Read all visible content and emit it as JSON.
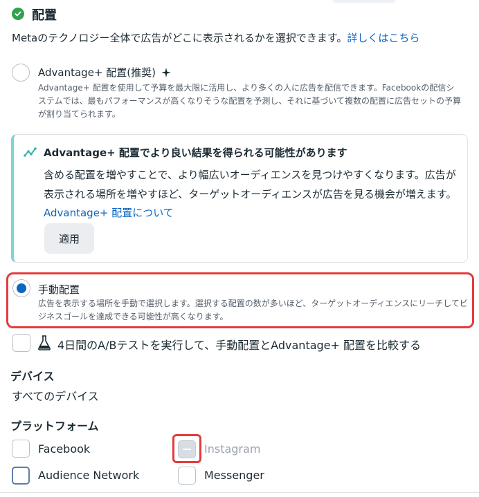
{
  "header": {
    "title": "配置",
    "description": "Metaのテクノロジー全体で広告がどこに表示されるかを選択できます。",
    "learn_more": "詳しくはこちら"
  },
  "advantage_option": {
    "title": "Advantage+ 配置(推奨)",
    "description": "Advantage+ 配置を使用して予算を最大限に活用し、より多くの人に広告を配信できます。Facebookの配信システムでは、最もパフォーマンスが高くなりそうな配置を予測し、それに基づいて複数の配置に広告セットの予算が割り当てられます。",
    "selected": false
  },
  "tip": {
    "title": "Advantage+ 配置でより良い結果を得られる可能性があります",
    "body": "含める配置を増やすことで、より幅広いオーディエンスを見つけやすくなります。広告が表示される場所を増やすほど、ターゲットオーディエンスが広告を見る機会が増えます。",
    "link": "Advantage+ 配置について",
    "apply_label": "適用"
  },
  "manual_option": {
    "title": "手動配置",
    "description": "広告を表示する場所を手動で選択します。選択する配置の数が多いほど、ターゲットオーディエンスにリーチしてビジネスゴールを達成できる可能性が高くなります。",
    "selected": true
  },
  "ab_test": {
    "label": "4日間のA/Bテストを実行して、手動配置とAdvantage+ 配置を比較する",
    "checked": false
  },
  "devices": {
    "title": "デバイス",
    "value": "すべてのデバイス"
  },
  "platforms": {
    "title": "プラットフォーム",
    "items": [
      {
        "label": "Facebook",
        "state": "unchecked"
      },
      {
        "label": "Instagram",
        "state": "indeterminate-disabled"
      },
      {
        "label": "Audience Network",
        "state": "unchecked-focused"
      },
      {
        "label": "Messenger",
        "state": "unchecked"
      }
    ]
  },
  "colors": {
    "accent": "#0a66c2",
    "success": "#31a24c",
    "highlight": "#e43b3b",
    "tip_border": "#7fd5cf"
  },
  "icons": [
    "check-circle-icon",
    "sparkle-icon",
    "trend-icon",
    "flask-icon"
  ]
}
